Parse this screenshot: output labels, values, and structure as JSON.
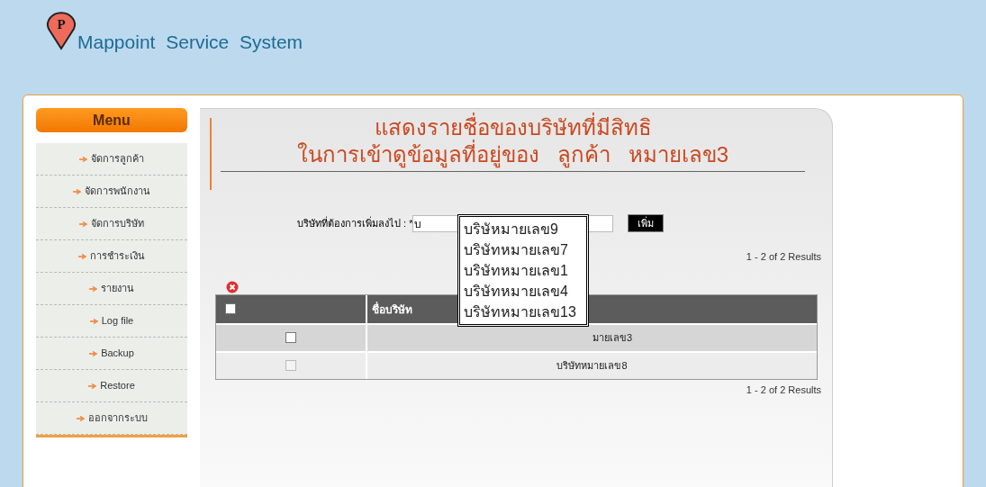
{
  "header": {
    "title": "Mappoint Service System",
    "logo_letter": "P"
  },
  "menu": {
    "title": "Menu",
    "items": [
      {
        "label": "จัดการลูกค้า"
      },
      {
        "label": "จัดการพนักงาน"
      },
      {
        "label": "จัดการบริษัท"
      },
      {
        "label": "การชำระเงิน"
      },
      {
        "label": "รายงาน"
      },
      {
        "label": "Log file"
      },
      {
        "label": "Backup"
      },
      {
        "label": "Restore"
      },
      {
        "label": "ออกจากระบบ"
      }
    ]
  },
  "content": {
    "title_lines": [
      "แสดงรายชื่อของบริษัทที่มีสิทธิ",
      "ในการเข้าดูข้อมูลที่อยู่ของ   ลูกค้า   หมายเลข3"
    ],
    "form": {
      "label": "บริษัทที่ต้องการเพิ่มลงไป : *",
      "value": "บ",
      "button": "เพิ่ม"
    },
    "suggestions": [
      "บริษัหมายเลข9",
      "บริษัทหมายเลข7",
      "บริษัทหมายเลข1",
      "บริษัทหมายเลข4",
      "บริษัทหมายเลข13"
    ],
    "results_top": "1 - 2 of 2 Results",
    "table": {
      "header_checked": false,
      "columns": [
        "ชื่อบริษัท"
      ],
      "rows": [
        {
          "checked": false,
          "disabled": false,
          "name": "มายเลข3",
          "covered": true
        },
        {
          "checked": false,
          "disabled": true,
          "name": "บริษัทหมายเลข8",
          "covered": false
        }
      ]
    },
    "results_bottom": "1 - 2 of 2 Results"
  }
}
